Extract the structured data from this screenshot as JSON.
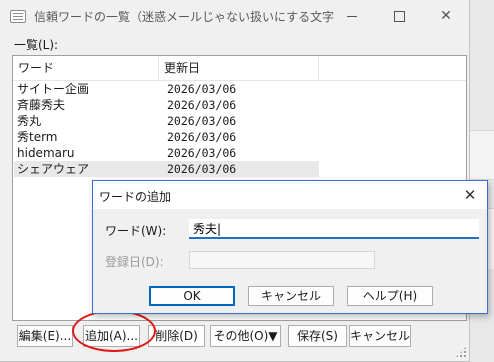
{
  "window": {
    "title": "信頼ワードの一覧（迷惑メールじゃない扱いにする文字列の..."
  },
  "list": {
    "label": "一覧(L):",
    "columns": [
      "ワード",
      "更新日"
    ],
    "rows": [
      {
        "word": "サイトー企画",
        "date": "2026/03/06"
      },
      {
        "word": "斉藤秀夫",
        "date": "2026/03/06"
      },
      {
        "word": "秀丸",
        "date": "2026/03/06"
      },
      {
        "word": "秀term",
        "date": "2026/03/06"
      },
      {
        "word": "hidemaru",
        "date": "2026/03/06"
      },
      {
        "word": "シェアウェア",
        "date": "2026/03/06"
      }
    ]
  },
  "buttons": {
    "edit": "編集(E)...",
    "add": "追加(A)...",
    "delete": "削除(D)",
    "other": "その他(O)▼",
    "save": "保存(S)",
    "cancel": "キャンセル"
  },
  "dialog": {
    "title": "ワードの追加",
    "word_label": "ワード(W):",
    "word_value": "秀夫|",
    "date_label": "登録日(D):",
    "ok": "OK",
    "cancel": "キャンセル",
    "help": "ヘルプ(H)"
  },
  "colors": {
    "accent": "#0067c0",
    "annotation": "#e01818",
    "dialog_border": "#3a6fd0"
  }
}
